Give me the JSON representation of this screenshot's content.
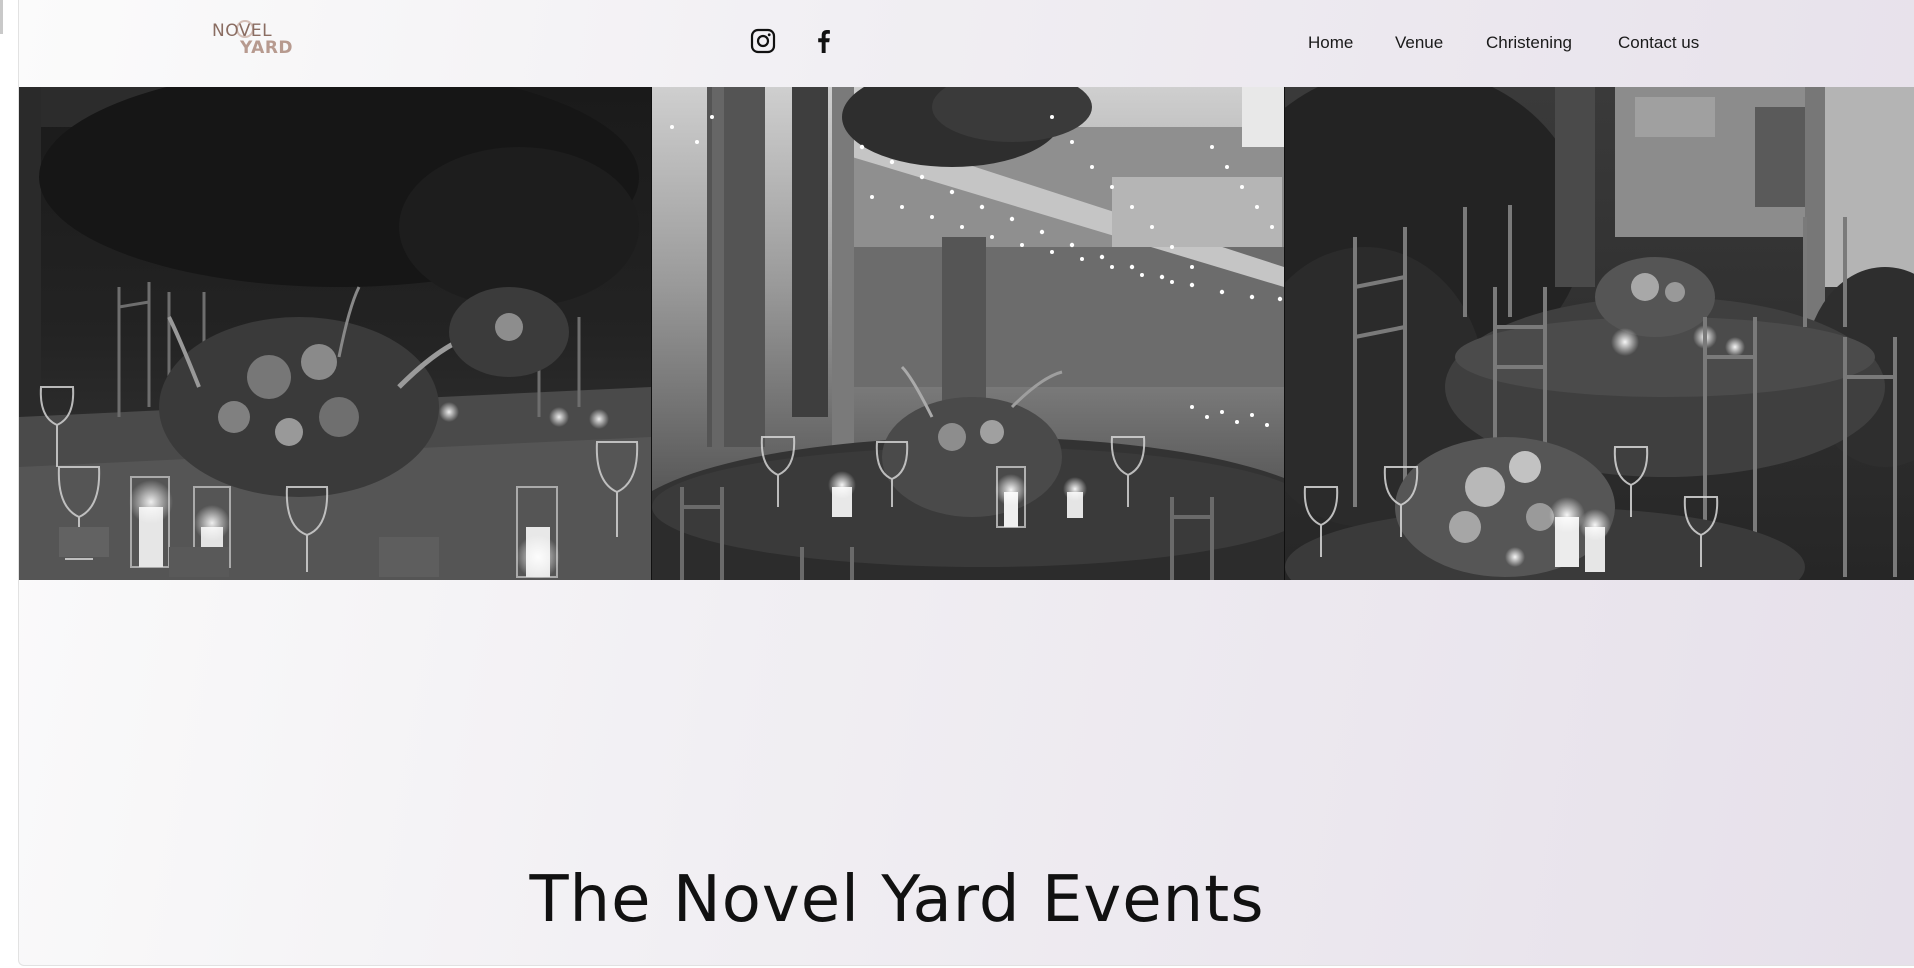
{
  "header": {
    "logo": {
      "line1": "NOVEL",
      "line2": "YARD"
    },
    "social": [
      {
        "icon": "instagram-icon"
      },
      {
        "icon": "facebook-icon"
      }
    ],
    "nav": {
      "home": "Home",
      "venue": "Venue",
      "christening": "Christening",
      "contact": "Contact us"
    }
  },
  "gallery": {
    "style": "grayscale",
    "photos": [
      {
        "subject": "table-centerpiece-candles"
      },
      {
        "subject": "string-lights-table-setting"
      },
      {
        "subject": "round-tables-garden"
      }
    ]
  },
  "main": {
    "title": "The Novel Yard Events"
  },
  "colors": {
    "logo_primary": "#8a6d62",
    "logo_secondary": "#b79a8f",
    "text": "#111111",
    "background_start": "#fbfbfb",
    "background_end": "#e6e0ea"
  }
}
